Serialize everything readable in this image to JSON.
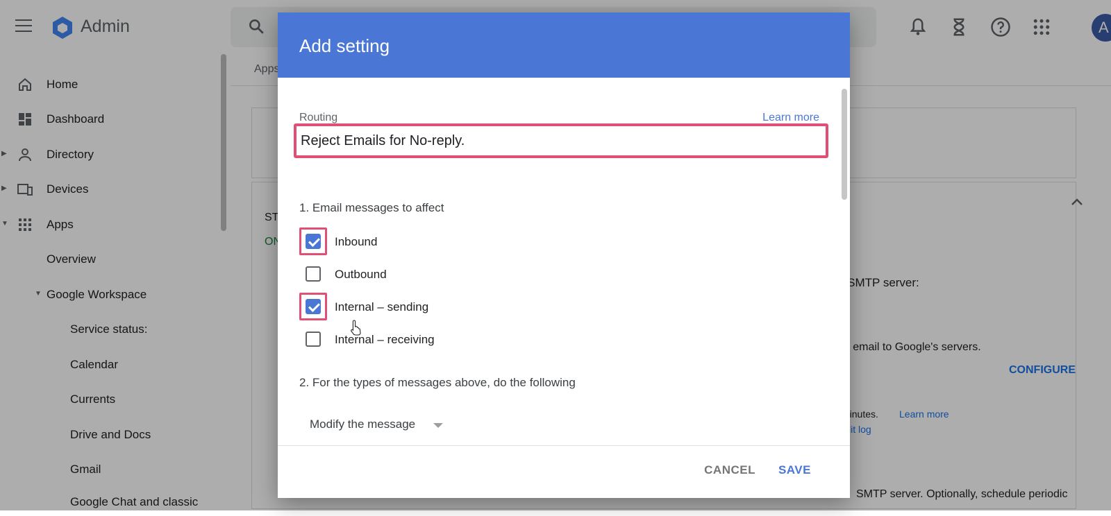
{
  "app": {
    "title": "Admin",
    "avatar_letter": "A",
    "breadcrumb": "Apps"
  },
  "sidebar": {
    "items": [
      {
        "label": "Home"
      },
      {
        "label": "Dashboard"
      },
      {
        "label": "Directory"
      },
      {
        "label": "Devices"
      },
      {
        "label": "Apps"
      },
      {
        "label": "Overview"
      },
      {
        "label": "Google Workspace"
      },
      {
        "label": "Service status:"
      },
      {
        "label": "Calendar"
      },
      {
        "label": "Currents"
      },
      {
        "label": "Drive and Docs"
      },
      {
        "label": "Gmail"
      },
      {
        "label": "Google Chat and classic"
      }
    ]
  },
  "background": {
    "status_label": "ST",
    "status_value": "ON",
    "smtp_text": "g SMTP server:",
    "email_text": "ng email to Google's servers.",
    "configure_label": "CONFIGURE",
    "minutes_text": "minutes.",
    "learn_more": "Learn more",
    "audit_log": "lit log",
    "optionally_text": "SMTP server. Optionally, schedule periodic"
  },
  "dialog": {
    "title": "Add setting",
    "routing_label": "Routing",
    "learn_more": "Learn more",
    "setting_name_value": "Reject Emails for No-reply.",
    "section1_title": "1. Email messages to affect",
    "checkboxes": [
      {
        "label": "Inbound",
        "checked": true
      },
      {
        "label": "Outbound",
        "checked": false
      },
      {
        "label": "Internal – sending",
        "checked": true
      },
      {
        "label": "Internal – receiving",
        "checked": false
      }
    ],
    "section2_title": "2. For the types of messages above, do the following",
    "action_dropdown": "Modify the message",
    "cancel_label": "CANCEL",
    "save_label": "SAVE"
  },
  "colors": {
    "accent": "#4a76d6",
    "highlight": "#e04f74"
  }
}
